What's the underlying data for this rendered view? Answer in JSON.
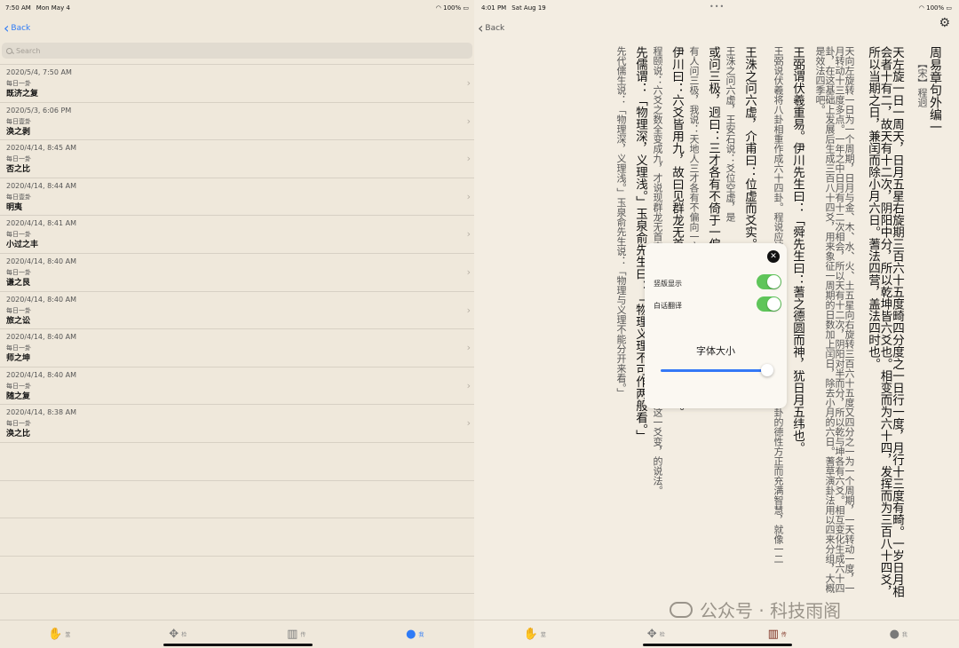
{
  "left": {
    "status": {
      "time": "7:50 AM",
      "date": "Mon May 4",
      "battery": "100%"
    },
    "back_label": "Back",
    "search_placeholder": "Search",
    "items": [
      {
        "date": "2020/5/4, 7:50 AM",
        "sub": "每日一卦",
        "name": "既济之复"
      },
      {
        "date": "2020/5/3, 6:06 PM",
        "sub": "每日壹卦",
        "name": "涣之剥"
      },
      {
        "date": "2020/4/14, 8:45 AM",
        "sub": "每日一卦",
        "name": "否之比"
      },
      {
        "date": "2020/4/14, 8:44 AM",
        "sub": "每日壹卦",
        "name": "明夷"
      },
      {
        "date": "2020/4/14, 8:41 AM",
        "sub": "每日一卦",
        "name": "小过之丰"
      },
      {
        "date": "2020/4/14, 8:40 AM",
        "sub": "每日一卦",
        "name": "谦之艮"
      },
      {
        "date": "2020/4/14, 8:40 AM",
        "sub": "每日一卦",
        "name": "旅之讼"
      },
      {
        "date": "2020/4/14, 8:40 AM",
        "sub": "每日一卦",
        "name": "师之坤"
      },
      {
        "date": "2020/4/14, 8:40 AM",
        "sub": "每日一卦",
        "name": "随之复"
      },
      {
        "date": "2020/4/14, 8:38 AM",
        "sub": "每日一卦",
        "name": "涣之比"
      }
    ],
    "tabs": [
      {
        "icon": "hand-icon",
        "label": "筮"
      },
      {
        "icon": "cross-arrows-icon",
        "label": "检"
      },
      {
        "icon": "book-icon",
        "label": "传"
      },
      {
        "icon": "person-icon",
        "label": "我"
      }
    ]
  },
  "right": {
    "status": {
      "time": "4:01 PM",
      "date": "Sat Aug 19",
      "battery": "100%"
    },
    "back_label": "Back",
    "title": "周易章句外编一",
    "author": "【宋】程迥",
    "columns": [
      {
        "type": "big",
        "text": "天左旋一日一周天，日月五星右旋期三百六十五度畸四分度之一日行一度，月行十三度有畸。一岁日月相会者十有二，故天有十二次，阴阳中分，所以乾坤皆六爻也。相变而为六十四，发挥而为三百八十四爻，所以当期之日，兼闰而除小月六日。蓍法四营，盖法四时也。"
      },
      {
        "type": "small",
        "text": "天向左旋转一日为一个周期，日月与金、木、水、火、土五星向右旋转三百六十五度又四分之一为一个周期，一天转动一度，一月转动十三度多点。一年之中日月有十二次相会，所以天有十二次，阴阳对半而分，所以乾与坤各有六爻。相互变化生成六十四卦，在这基础上发展后生成三百八十四爻，用来象征一周期的日数加上闰日，除去小月的六日。蓍草演卦法用以四来分组，大概是效法四季吧。"
      },
      {
        "type": "big",
        "text": "王弼谓伏羲重易。伊川先生曰：「舜先生曰：蓍之德圆而神，犹日月五纬也。"
      },
      {
        "type": "small",
        "text": "王弼说伏羲将八卦相重作成六十四卦。程说应该是正确的了。司马迁、扬雄不支星。卦的德性方正而充满智慧，就像一二"
      },
      {
        "type": "big",
        "text": "王洙之问六虚，介甫曰：位虚而爻实。"
      },
      {
        "type": "small",
        "text": "王洙之问六虚，王安石说：爻位空虚，是"
      },
      {
        "type": "big",
        "text": "或问三极，迥曰：三才各有不倚于一偏处。"
      },
      {
        "type": "small",
        "text": "有人问三极，我说：天地人三才各有不偏向一方之处。"
      },
      {
        "type": "big",
        "text": "伊川曰：六爻皆用九，故曰见群龙无首吉。以临川只在上九一爻为非。"
      },
      {
        "type": "small",
        "text": "程颐说：六爻之数全变成九，才说现群龙无首吉。因为程颐不赞成王安石，只有上九这一爻变，的说法。"
      },
      {
        "type": "big",
        "text": "先儒谓：「物理深，义理浅。」玉泉俞先生曰：「物理义理不可作两般看。」"
      },
      {
        "type": "small",
        "text": "先代儒生说：「物理深，义理浅。」玉泉俞先生说：「物理与义理不能分开来看。」"
      }
    ],
    "popup": {
      "opt1_label": "竖版显示",
      "opt2_label": "白话翻译",
      "font_size_label": "字体大小",
      "font_size_value": 1.0
    },
    "tabs": [
      {
        "icon": "hand-icon",
        "label": "筮"
      },
      {
        "icon": "cross-arrows-icon",
        "label": "检"
      },
      {
        "icon": "book-icon",
        "label": "传"
      },
      {
        "icon": "person-icon",
        "label": "我"
      }
    ],
    "watermark": "公众号 · 科技雨阁"
  }
}
